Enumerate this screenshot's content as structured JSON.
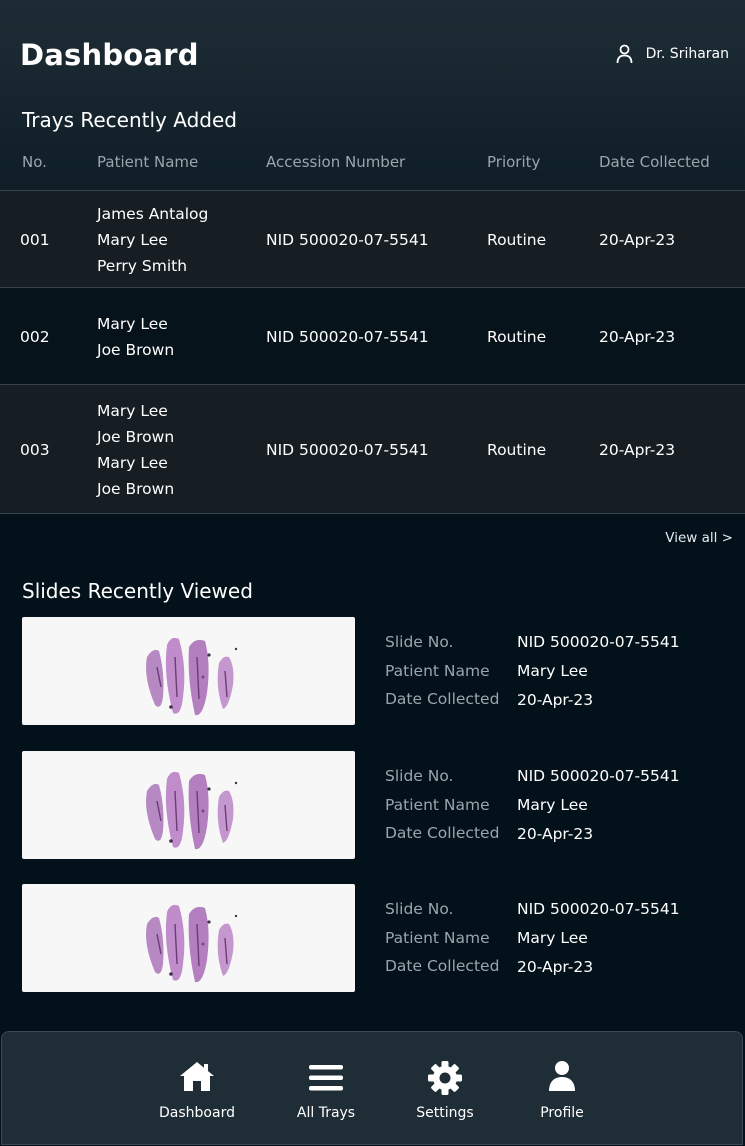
{
  "header": {
    "title": "Dashboard",
    "user_name": "Dr. Sriharan"
  },
  "trays": {
    "section_title": "Trays Recently Added",
    "columns": [
      "No.",
      "Patient Name",
      "Accession Number",
      "Priority",
      "Date Collected"
    ],
    "rows": [
      {
        "no": "001",
        "names": [
          "James Antalog",
          "Mary Lee",
          "Perry Smith"
        ],
        "accession": "NID 500020-07-5541",
        "priority": "Routine",
        "date": "20-Apr-23"
      },
      {
        "no": "002",
        "names": [
          "Mary Lee",
          "Joe Brown"
        ],
        "accession": "NID 500020-07-5541",
        "priority": "Routine",
        "date": "20-Apr-23"
      },
      {
        "no": "003",
        "names": [
          "Mary Lee",
          "Joe Brown",
          "Mary Lee",
          "Joe Brown"
        ],
        "accession": "NID 500020-07-5541",
        "priority": "Routine",
        "date": "20-Apr-23"
      }
    ],
    "view_all": "View all >"
  },
  "slides": {
    "section_title": "Slides Recently Viewed",
    "labels": {
      "slide_no": "Slide No.",
      "patient_name": "Patient Name",
      "date_collected": "Date Collected"
    },
    "items": [
      {
        "slide_no": "NID 500020-07-5541",
        "patient_name": "Mary Lee",
        "date_collected": "20-Apr-23"
      },
      {
        "slide_no": "NID 500020-07-5541",
        "patient_name": "Mary Lee",
        "date_collected": "20-Apr-23"
      },
      {
        "slide_no": "NID 500020-07-5541",
        "patient_name": "Mary Lee",
        "date_collected": "20-Apr-23"
      }
    ]
  },
  "nav": {
    "items": [
      {
        "label": "Dashboard",
        "icon": "home-icon"
      },
      {
        "label": "All Trays",
        "icon": "menu-icon"
      },
      {
        "label": "Settings",
        "icon": "gear-icon"
      },
      {
        "label": "Profile",
        "icon": "user-icon"
      }
    ]
  },
  "colors": {
    "background": "#03111a",
    "header_gradient_top": "#1d2b34",
    "muted_text": "#9aa6ae",
    "row_alt": "#161e24",
    "divider": "#34424a",
    "nav_background": "#1f2d36"
  }
}
